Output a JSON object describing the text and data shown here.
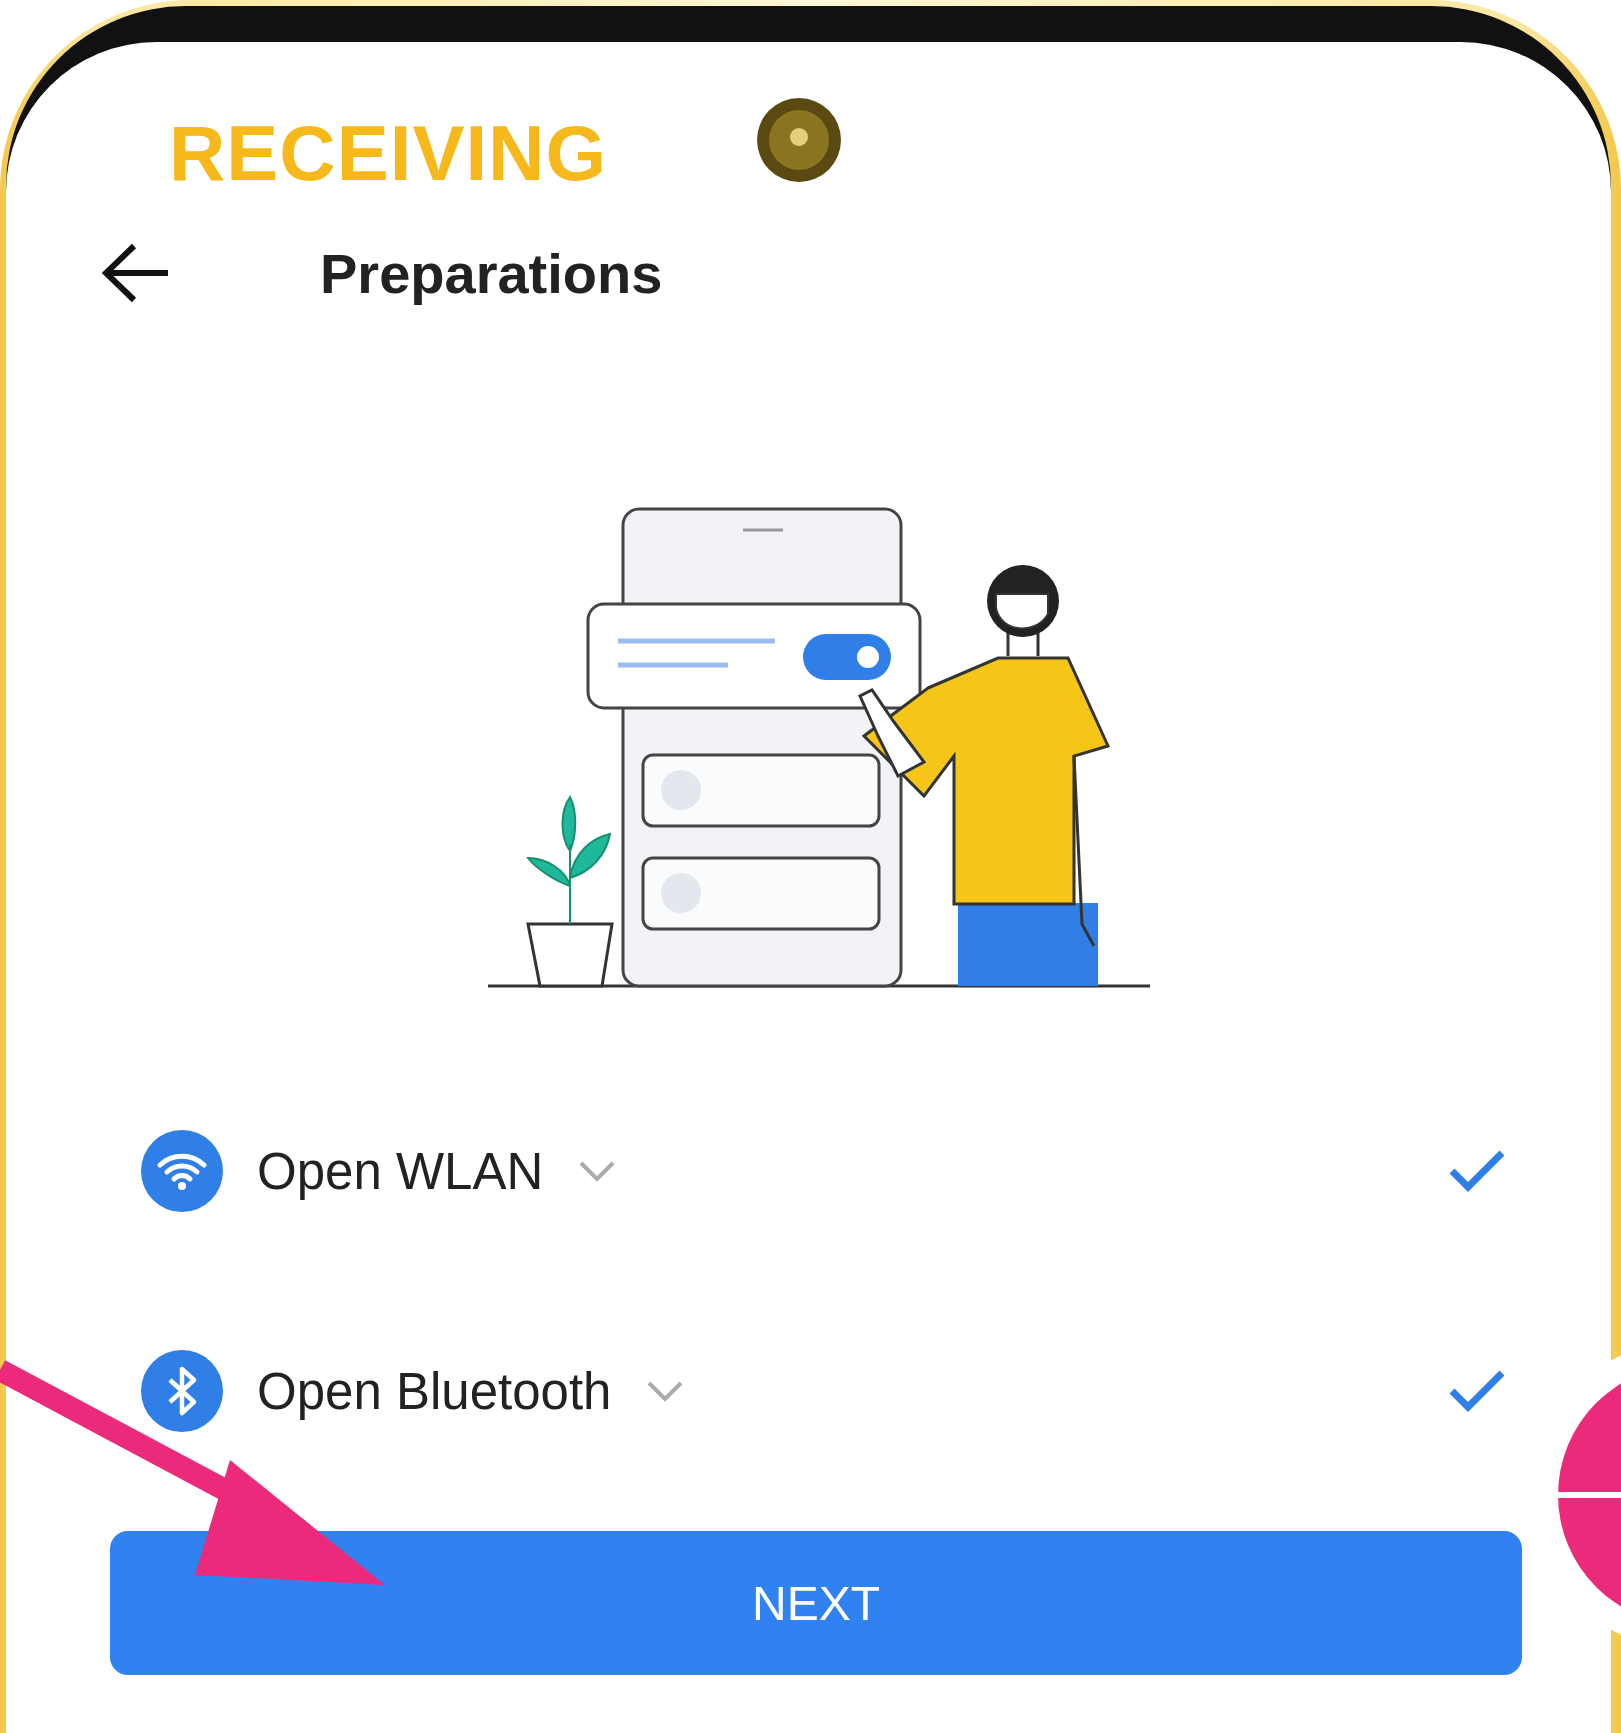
{
  "header_label": "RECEIVING",
  "title": "Preparations",
  "items": [
    {
      "kind": "wifi",
      "label": "Open WLAN",
      "expanded": false,
      "checked": true
    },
    {
      "kind": "bluetooth",
      "label": "Open Bluetooth",
      "expanded": false,
      "checked": true
    }
  ],
  "button": "NEXT"
}
